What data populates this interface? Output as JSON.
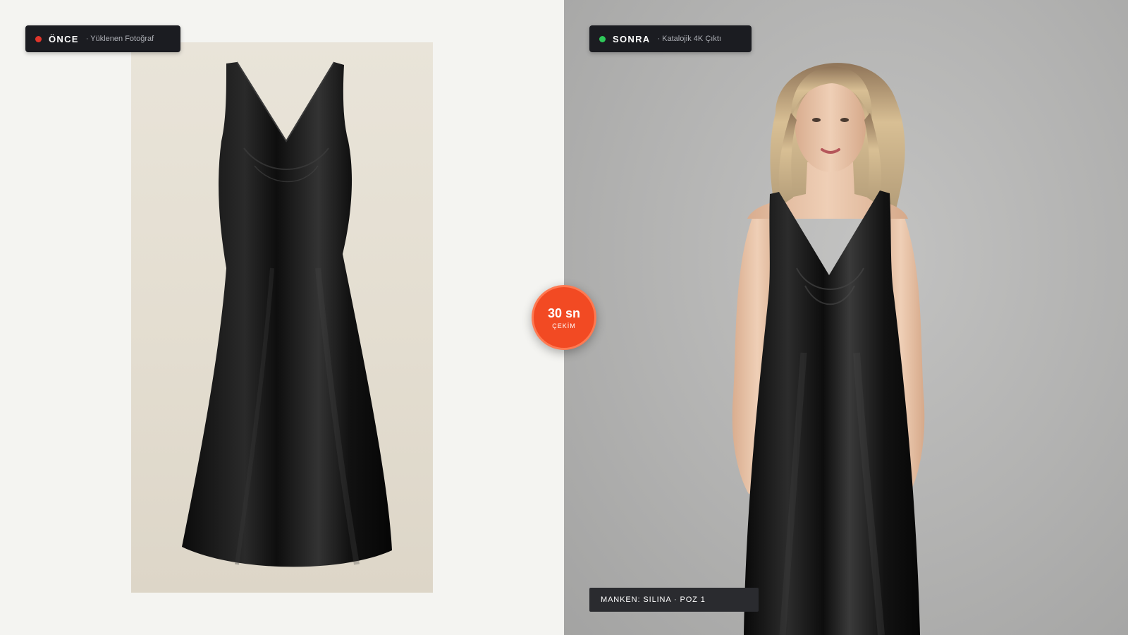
{
  "before": {
    "badge_title": "ÖNCE",
    "badge_subtitle": "· Yüklenen Fotoğraf",
    "dot_color": "#e0352b"
  },
  "after": {
    "badge_title": "SONRA",
    "badge_subtitle": "· Katalojik 4K Çıktı",
    "dot_color": "#2fc85a",
    "caption": "MANKEN: SILINA · POZ 1"
  },
  "timer": {
    "value": "30 sn",
    "label": "ÇEKİM",
    "color": "#f24a23"
  }
}
